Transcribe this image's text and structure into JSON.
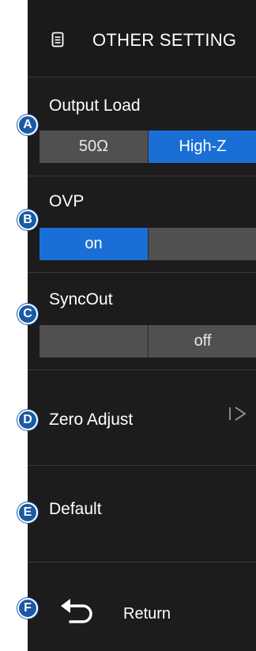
{
  "header": {
    "title": "OTHER SETTING",
    "icon": "document-icon"
  },
  "output_load": {
    "label": "Output Load",
    "options": [
      "50Ω",
      "High-Z"
    ],
    "selected": "High-Z"
  },
  "ovp": {
    "label": "OVP",
    "options": [
      "on",
      ""
    ],
    "selected": "on"
  },
  "sync_out": {
    "label": "SyncOut",
    "options": [
      "",
      "off"
    ],
    "selected": "off"
  },
  "zero_adjust": {
    "label": "Zero Adjust",
    "icon": "submenu-arrow-icon"
  },
  "default": {
    "label": "Default"
  },
  "return": {
    "label": "Return",
    "icon": "return-arrow-icon"
  },
  "badges": [
    "A",
    "B",
    "C",
    "D",
    "E",
    "F"
  ],
  "colors": {
    "panel": "#1c1c1c",
    "selected": "#1a6fd6",
    "unselected": "#505050",
    "badge": "#1a5aa5"
  }
}
